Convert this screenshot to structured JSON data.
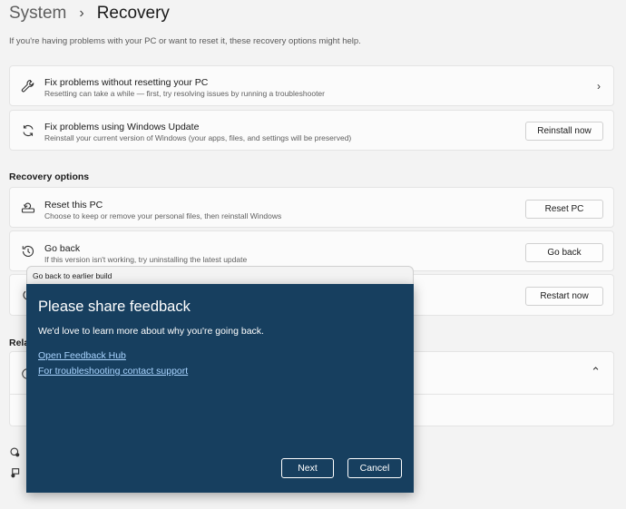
{
  "breadcrumb": {
    "parent": "System",
    "separator": "›",
    "current": "Recovery"
  },
  "description": "If you're having problems with your PC or want to reset it, these recovery options might help.",
  "top_cards": [
    {
      "icon": "wrench-icon",
      "title": "Fix problems without resetting your PC",
      "subtitle": "Resetting can take a while — first, try resolving issues by running a troubleshooter"
    },
    {
      "icon": "sync-icon",
      "title": "Fix problems using Windows Update",
      "subtitle": "Reinstall your current version of Windows (your apps, files, and settings will be preserved)",
      "button": "Reinstall now"
    }
  ],
  "recovery_options_heading": "Recovery options",
  "options": [
    {
      "icon": "reset-pc-icon",
      "title": "Reset this PC",
      "subtitle": "Choose to keep or remove your personal files, then reinstall Windows",
      "button": "Reset PC"
    },
    {
      "icon": "history-icon",
      "title": "Go back",
      "subtitle": "If this version isn't working, try uninstalling the latest update",
      "button": "Go back"
    },
    {
      "icon": "power-icon",
      "button": "Restart now"
    }
  ],
  "related_heading_partial": "Rela",
  "dialog": {
    "window_title": "Go back to earlier build",
    "heading": "Please share feedback",
    "message": "We'd love to learn more about why you're going back.",
    "link_feedback": "Open Feedback Hub",
    "link_support": "For troubleshooting contact support",
    "next_label": "Next",
    "cancel_label": "Cancel"
  }
}
